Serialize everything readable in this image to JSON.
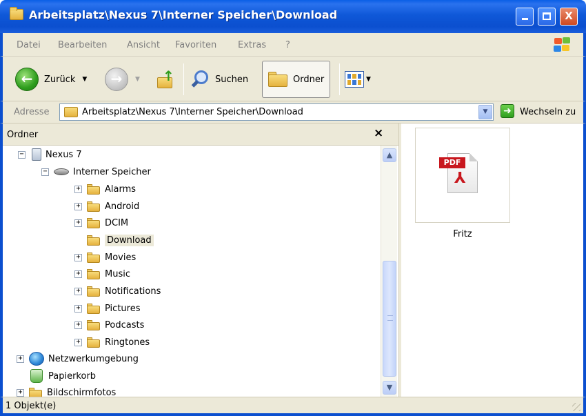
{
  "window": {
    "title": "Arbeitsplatz\\Nexus 7\\Interner Speicher\\Download",
    "controls": {
      "minimize_icon": "minimize-icon",
      "maximize_icon": "maximize-icon",
      "close_label": "X"
    }
  },
  "menubar": {
    "items": [
      "Datei",
      "Bearbeiten",
      "Ansicht",
      "Favoriten",
      "Extras",
      "?"
    ]
  },
  "toolbar": {
    "back_label": "Zurück",
    "back_glyph": "←",
    "forward_glyph": "→",
    "dropdown_glyph": "▼",
    "search_label": "Suchen",
    "folders_label": "Ordner"
  },
  "addressbar": {
    "label": "Adresse",
    "path": "Arbeitsplatz\\Nexus 7\\Interner Speicher\\Download",
    "dropdown_glyph": "▼",
    "go_glyph": "➜",
    "go_label": "Wechseln zu"
  },
  "folder_pane": {
    "title": "Ordner",
    "close_glyph": "×",
    "tree": {
      "device": "Nexus 7",
      "storage": "Interner Speicher",
      "folders": [
        "Alarms",
        "Android",
        "DCIM",
        "Download",
        "Movies",
        "Music",
        "Notifications",
        "Pictures",
        "Podcasts",
        "Ringtones"
      ],
      "selected": "Download",
      "network": "Netzwerkumgebung",
      "recycle_bin": "Papierkorb",
      "partial": "Bildschirmfotos"
    },
    "expander_collapsed": "+",
    "expander_expanded": "−",
    "scroll_up_glyph": "▲",
    "scroll_down_glyph": "▼"
  },
  "file_view": {
    "files": [
      {
        "name": "Fritz",
        "type_tag": "PDF",
        "icon": "pdf-file-icon"
      }
    ]
  },
  "statusbar": {
    "text": "1 Objekt(e)"
  }
}
